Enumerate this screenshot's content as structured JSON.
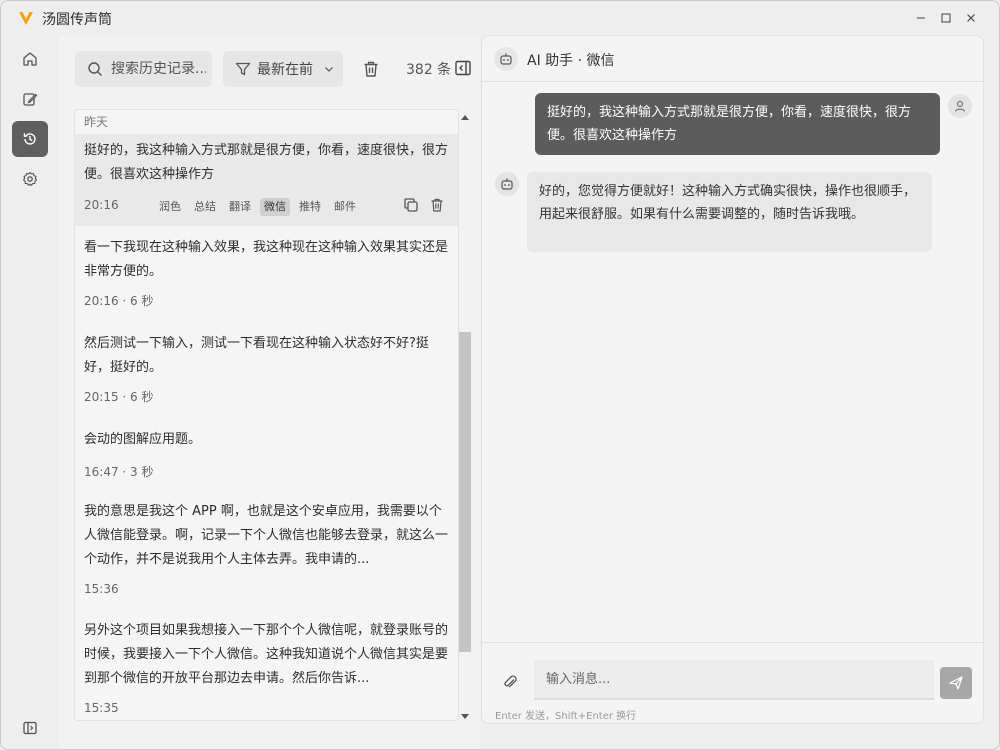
{
  "app": {
    "title": "汤圆传声筒",
    "accent": "#f5a300"
  },
  "window_controls": {
    "minimize": "minimize-icon",
    "maximize": "maximize-icon",
    "close": "close-icon"
  },
  "rail": {
    "items": [
      {
        "name": "home-icon"
      },
      {
        "name": "edit-icon"
      },
      {
        "name": "history-icon",
        "active": true
      },
      {
        "name": "gear-icon"
      }
    ],
    "bottom": "sidebar-toggle-icon"
  },
  "history": {
    "search_placeholder": "搜索历史记录...",
    "sort_label": "最新在前",
    "count": "382 条",
    "group_label": "昨天",
    "items": [
      {
        "text": "挺好的，我这种输入方式那就是很方便，你看，速度很快，很方便。很喜欢这种操作方",
        "time": "20:16",
        "actions": [
          "润色",
          "总结",
          "翻译",
          "微信",
          "推特",
          "邮件"
        ],
        "active_action": "微信"
      },
      {
        "text": "看一下我现在这种输入效果，我这种现在这种输入效果其实还是非常方便的。",
        "meta": "20:16 · 6 秒"
      },
      {
        "text": "然后测试一下输入，测试一下看现在这种输入状态好不好?挺好，挺好的。",
        "meta": "20:15 · 6 秒"
      },
      {
        "text": "会动的图解应用题。",
        "meta": "16:47 · 3 秒"
      },
      {
        "text": "我的意思是我这个 APP 啊，也就是这个安卓应用，我需要以个人微信能登录。啊，记录一下个人微信也能够去登录，就这么一个动作，并不是说我用个人主体去弄。我申请的...",
        "meta": "15:36"
      },
      {
        "text": "另外这个项目如果我想接入一下那个个人微信呢，就登录账号的时候，我要接入一下个人微信。这种我知道说个人微信其实是要到那个微信的开放平台那边去申请。然后你告诉...",
        "meta": "15:35"
      }
    ]
  },
  "chat": {
    "title": "AI 助手 · 微信",
    "user_message": "挺好的，我这种输入方式那就是很方便，你看，速度很快，很方便。很喜欢这种操作方",
    "bot_message": "好的，您觉得方便就好！这种输入方式确实很快，操作也很顺手，用起来很舒服。如果有什么需要调整的，随时告诉我哦。",
    "input_placeholder": "输入消息...",
    "hint": "Enter 发送，Shift+Enter 换行"
  }
}
